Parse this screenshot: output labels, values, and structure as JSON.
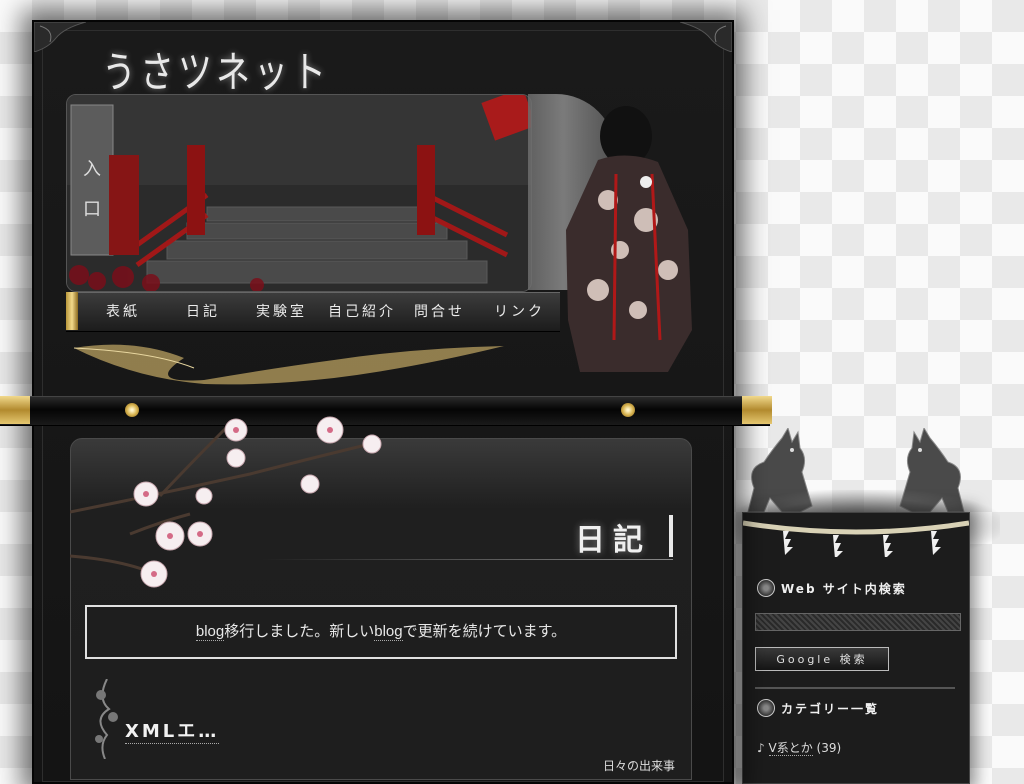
{
  "site": {
    "logo": "うさツネット"
  },
  "nav": [
    {
      "label": "表紙"
    },
    {
      "label": "日記"
    },
    {
      "label": "実験室"
    },
    {
      "label": "自己紹介"
    },
    {
      "label": "問合せ"
    },
    {
      "label": "リンク"
    }
  ],
  "main": {
    "section_title": "日記",
    "notice": {
      "link1": "blog",
      "text1": "移行しました。新しい",
      "link2": "blog",
      "text2": "で更新を続けています。"
    },
    "post": {
      "title": "XMLエ…",
      "category": "日々の出来事"
    }
  },
  "sidebar": {
    "search": {
      "heading": "Web サイト内検索",
      "input_value": "",
      "button_label": "Google 検索"
    },
    "categories": {
      "heading": "カテゴリー一覧",
      "items": [
        {
          "label": "V系とか",
          "count": "(39)"
        }
      ]
    }
  },
  "colors": {
    "frame": "#141414",
    "gold": "#d9b552",
    "text": "#ececec"
  }
}
